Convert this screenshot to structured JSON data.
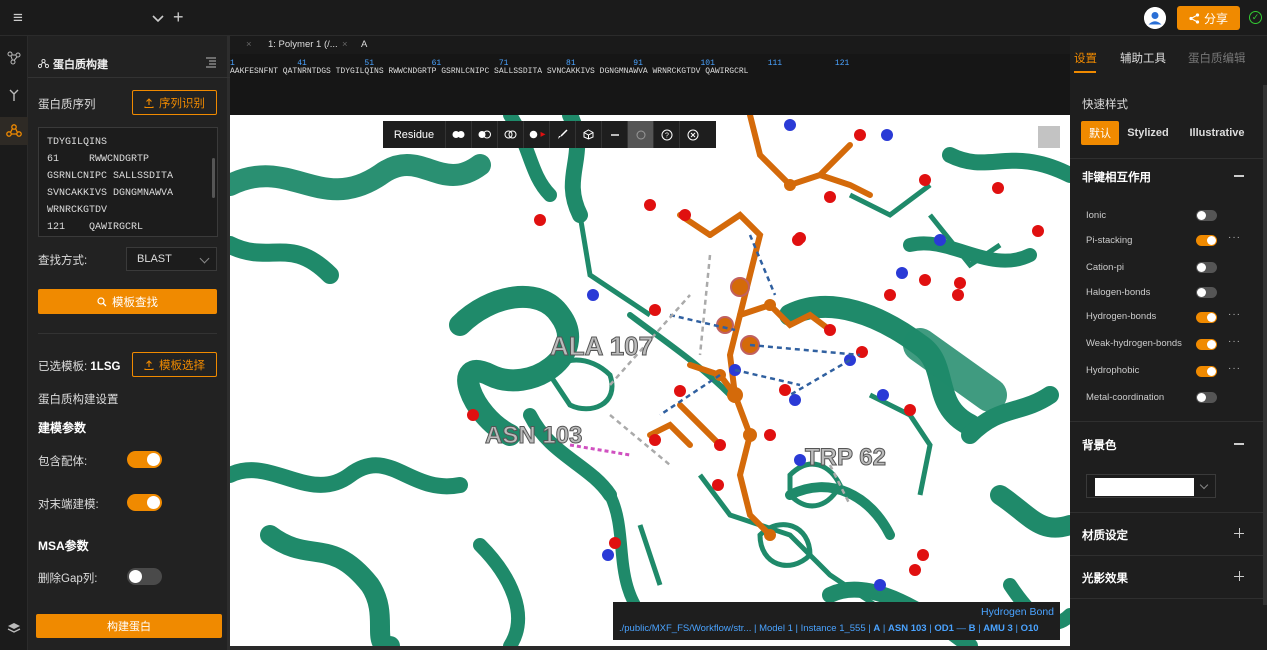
{
  "topbar": {
    "share_label": "分享"
  },
  "left_panel": {
    "title": "蛋白质构建",
    "seq_label": "蛋白质序列",
    "seq_recog_button": "序列识别",
    "sequence_lines": [
      "TDYGILQINS",
      "61     RWWCNDGRTP",
      "GSRNLCNIPC SALLSSDITA",
      "SVNCAKKIVS DGNGMNAWVA",
      "WRNRCKGTDV",
      "121    QAWIRGCRL"
    ],
    "search_method_label": "查找方式:",
    "search_method_value": "BLAST",
    "template_search_button": "模板查找",
    "selected_template_label": "已选模板:",
    "selected_template_value": "1LSG",
    "template_select_button": "模板选择",
    "build_settings_label": "蛋白质构建设置",
    "model_params_label": "建模参数",
    "include_ligand_label": "包含配体:",
    "include_ligand_on": true,
    "terminal_model_label": "对末端建模:",
    "terminal_model_on": true,
    "msa_params_label": "MSA参数",
    "delete_gap_label": "删除Gap列:",
    "delete_gap_on": false,
    "build_button": "构建蛋白"
  },
  "sequence_viewer": {
    "tab_1": "1: Polymer 1 (/...",
    "tab_2": "A",
    "numbers_line": "1             41            51            61            71            81            91            101           111           121",
    "residues_line": "AAKFESNFNT QATNRNTDGS TDYGILQINS RWWCNDGRTP GSRNLCNIPC SALLSSDITA SVNCAKKIVS DGNGMNAWVA WRNRCKGTDV QAWIRGCRL"
  },
  "viewer": {
    "residue_button": "Residue",
    "labels": {
      "ala": "ALA 107",
      "asn": "ASN 103",
      "trp": "TRP 62"
    },
    "status_title": "Hydrogen Bond",
    "status_path": "./public/MXF_FS/Workflow/str...",
    "status_model": "Model 1",
    "status_instance": "Instance 1_555",
    "status_chain": "A",
    "status_atom1": "ASN 103",
    "status_atom1b": "OD1",
    "status_chain2": "B",
    "status_atom2": "AMU 3",
    "status_atom2b": "O10"
  },
  "right_panel": {
    "tabs": [
      "设置",
      "辅助工具",
      "蛋白质编辑"
    ],
    "quick_style_label": "快速样式",
    "style_buttons": [
      "默认",
      "Stylized",
      "Illustrative"
    ],
    "noncovalent_label": "非键相互作用",
    "interactions": [
      {
        "name": "Ionic",
        "on": false
      },
      {
        "name": "Pi-stacking",
        "on": true
      },
      {
        "name": "Cation-pi",
        "on": false
      },
      {
        "name": "Halogen-bonds",
        "on": false
      },
      {
        "name": "Hydrogen-bonds",
        "on": true
      },
      {
        "name": "Weak-hydrogen-bonds",
        "on": true
      },
      {
        "name": "Hydrophobic",
        "on": true
      },
      {
        "name": "Metal-coordination",
        "on": false
      }
    ],
    "bg_color_label": "背景色",
    "bg_color_value": "#ffffff",
    "material_label": "材质设定",
    "lighting_label": "光影效果"
  },
  "colors": {
    "accent": "#f08a00",
    "protein": "#1f8a6a",
    "ligand": "#d46a0a",
    "oxygen": "#e01010",
    "nitrogen": "#2a3ad6"
  }
}
